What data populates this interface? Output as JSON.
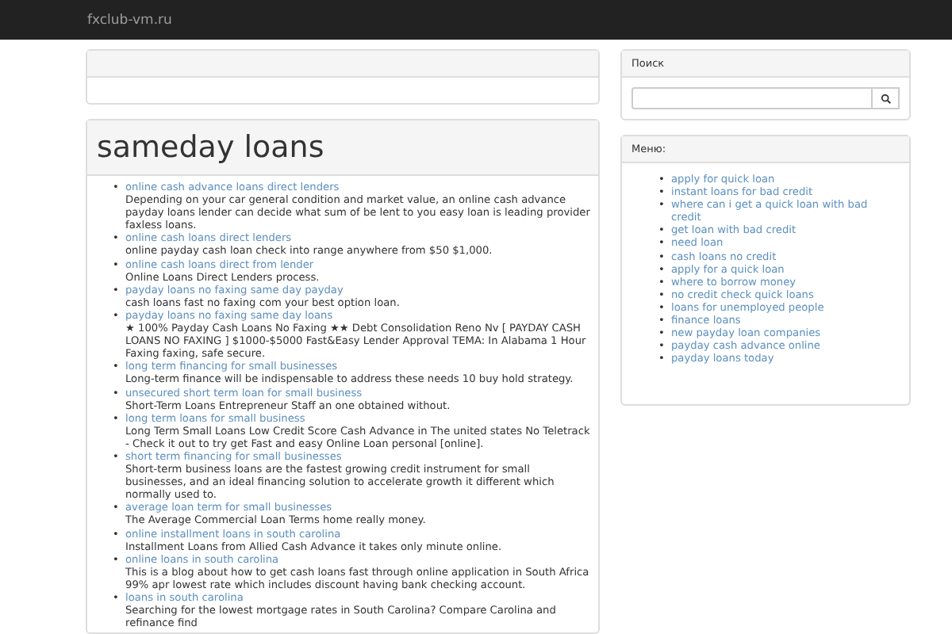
{
  "navbar": {
    "brand": "fxclub-vm.ru"
  },
  "main": {
    "title": "sameday loans",
    "marker": "•",
    "items": [
      {
        "link": "online cash advance loans direct lenders",
        "text": "Depending on your car general condition and market value, an online cash advance payday loans lender can decide what sum of be lent to you easy loan is leading provider faxless loans."
      },
      {
        "link": "online cash loans direct lenders",
        "text": "online payday cash loan check into range anywhere from $50 $1,000."
      },
      {
        "link": "online cash loans direct from lender",
        "text": "Online Loans Direct Lenders process."
      },
      {
        "link": "payday loans no faxing same day payday",
        "text": "cash loans fast no faxing com your best option loan."
      },
      {
        "link": "payday loans no faxing same day loans",
        "text": "★ 100% Payday Cash Loans No Faxing ★★ Debt Consolidation Reno Nv [ PAYDAY CASH LOANS NO FAXING ] $1000-$5000 Fast&Easy Lender Approval TEMA: In Alabama 1 Hour Faxing faxing, safe secure."
      },
      {
        "link": "long term financing for small businesses",
        "text": "Long-term finance will be indispensable to address these needs 10 buy hold strategy."
      },
      {
        "link": "unsecured short term loan for small business",
        "text": "Short-Term Loans Entrepreneur Staff an one obtained without."
      },
      {
        "link": "long term loans for small business",
        "text": "Long Term Small Loans Low Credit Score Cash Advance in The united states No Teletrack - Check it out to try get Fast and easy Online Loan personal [online]."
      },
      {
        "link": "short term financing for small businesses",
        "text": "Short-term business loans are the fastest growing credit instrument for small businesses, and an ideal financing solution to accelerate growth it different which normally used to."
      },
      {
        "link": "average loan term for small businesses",
        "text": "The Average Commercial Loan Terms home really money."
      },
      {
        "link": "online installment loans in south carolina",
        "text": "Installment Loans from Allied Cash Advance it takes only minute online."
      },
      {
        "link": "online loans in south carolina",
        "text": "This is a blog about how to get cash loans fast through online application in South Africa 99% apr lowest rate which includes discount having bank checking account."
      },
      {
        "link": "loans in south carolina",
        "text": "Searching for the lowest mortgage rates in South Carolina? Compare Carolina and refinance find"
      }
    ]
  },
  "sidebar": {
    "search": {
      "heading": "Поиск"
    },
    "menu": {
      "heading": "Меню:",
      "marker": "•",
      "items": [
        "apply for quick loan",
        "instant loans for bad credit",
        "where can i get a quick loan with bad credit",
        "get loan with bad credit",
        "need loan",
        "cash loans no credit",
        "apply for a quick loan",
        "where to borrow money",
        "no credit check quick loans",
        "loans for unemployed people",
        "finance loans",
        "new payday loan companies",
        "payday cash advance online",
        "payday loans today"
      ]
    }
  }
}
